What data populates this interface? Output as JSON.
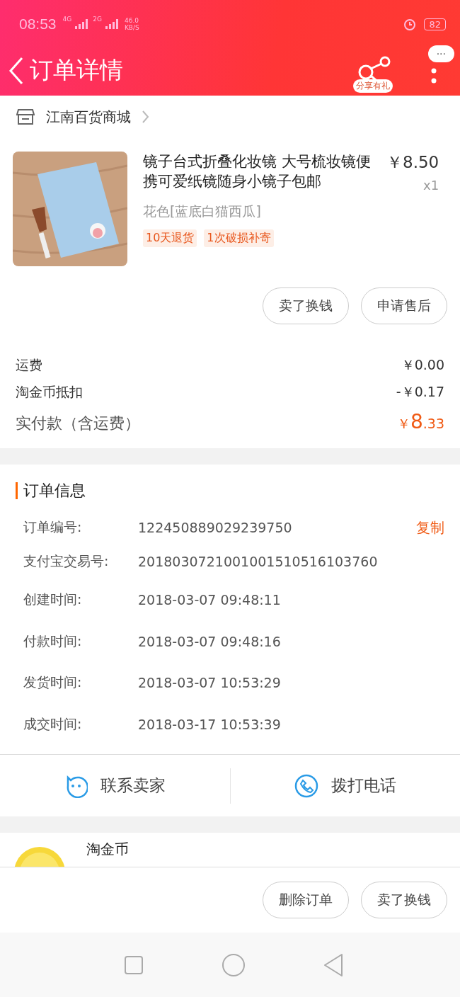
{
  "status_bar": {
    "time": "08:53",
    "network_1": "4G",
    "network_2": "2G",
    "speed": "46.0",
    "speed_unit": "KB/S",
    "battery": "82"
  },
  "header": {
    "title": "订单详情",
    "share_label": "分享有礼",
    "more": "···"
  },
  "shop": {
    "name": "江南百货商城"
  },
  "product": {
    "kind": "picture",
    "title": "镜子台式折叠化妆镜 大号梳妆镜便携可爱纸镜随身小镜子包邮",
    "price": "￥8.50",
    "quantity": "x1",
    "variant": "花色[蓝底白猫西瓜]",
    "tags": [
      "10天退货",
      "1次破损补寄"
    ]
  },
  "item_buttons": [
    "卖了换钱",
    "申请售后"
  ],
  "fees": [
    {
      "label": "运费",
      "value": "￥0.00"
    },
    {
      "label": "淘金币抵扣",
      "value": "-￥0.17"
    }
  ],
  "total": {
    "label": "实付款（含运费）",
    "symbol": "￥",
    "integer": "8",
    "fraction": ".33"
  },
  "order_info": {
    "title": "订单信息",
    "rows": [
      {
        "label": "订单编号:",
        "value": "122450889029239750",
        "action": "复制"
      },
      {
        "label": "支付宝交易号:",
        "value": "2018030721001001510516103760"
      },
      {
        "label": "创建时间:",
        "value": "2018-03-07 09:48:11"
      },
      {
        "label": "付款时间:",
        "value": "2018-03-07 09:48:16"
      },
      {
        "label": "发货时间:",
        "value": "2018-03-07 10:53:29"
      },
      {
        "label": "成交时间:",
        "value": "2018-03-17 10:53:39"
      }
    ]
  },
  "contact": [
    {
      "kind": "chat",
      "label": "联系卖家"
    },
    {
      "kind": "phone",
      "label": "拨打电话"
    }
  ],
  "coins": {
    "title": "淘金币"
  },
  "bottom_buttons": [
    "删除订单",
    "卖了换钱"
  ]
}
